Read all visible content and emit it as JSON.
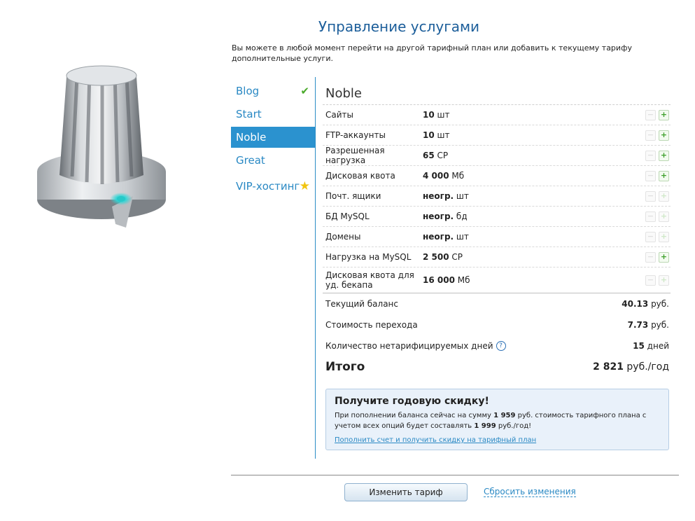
{
  "header": {
    "title": "Управление услугами",
    "intro": "Вы можете в любой момент перейти на другой тарифный план или добавить к текущему тарифу дополнительные услуги."
  },
  "tabs": [
    {
      "label": "Blog",
      "icon": "check-icon"
    },
    {
      "label": "Start"
    },
    {
      "label": "Noble",
      "active": true
    },
    {
      "label": "Great"
    },
    {
      "label": "VIP-хостинг",
      "icon": "star-icon"
    }
  ],
  "plan": {
    "name": "Noble",
    "options": [
      {
        "name": "Сайты",
        "value": "10",
        "unit": "шт"
      },
      {
        "name": "FTP-аккаунты",
        "value": "10",
        "unit": "шт"
      },
      {
        "name": "Разрешенная нагрузка",
        "value": "65",
        "unit": "CP"
      },
      {
        "name": "Дисковая квота",
        "value": "4 000",
        "unit": "Мб"
      },
      {
        "name": "Почт. ящики",
        "value": "неогр.",
        "unit": "шт"
      },
      {
        "name": "БД MySQL",
        "value": "неогр.",
        "unit": "бд"
      },
      {
        "name": "Домены",
        "value": "неогр.",
        "unit": "шт"
      },
      {
        "name": "Нагрузка на MySQL",
        "value": "2 500",
        "unit": "CP"
      },
      {
        "name": "Дисковая квота для уд. бекапа",
        "value": "16 000",
        "unit": "Мб"
      }
    ]
  },
  "summary": {
    "balance_label": "Текущий баланс",
    "balance_value": "40.13",
    "balance_unit": "руб.",
    "transfer_label": "Стоимость перехода",
    "transfer_value": "7.73",
    "transfer_unit": "руб.",
    "days_label": "Количество нетарифицируемых дней",
    "days_value": "15",
    "days_unit": "дней",
    "total_label": "Итого",
    "total_value": "2 821",
    "total_unit": "руб./год"
  },
  "promo": {
    "title": "Получите годовую скидку!",
    "text_1": "При пополнении баланса сейчас на сумму ",
    "amount_1": "1 959",
    "text_2": " руб. стоимость тарифного плана с учетом всех опций будет составлять ",
    "amount_2": "1 999",
    "text_3": " руб./год!",
    "link": "Пополнить счет и получить скидку на тарифный план"
  },
  "actions": {
    "change": "Изменить тариф",
    "reset": "Сбросить изменения"
  },
  "colors": {
    "accent": "#2b92cf",
    "title": "#1c5e9a",
    "plus": "#3ea02b"
  }
}
